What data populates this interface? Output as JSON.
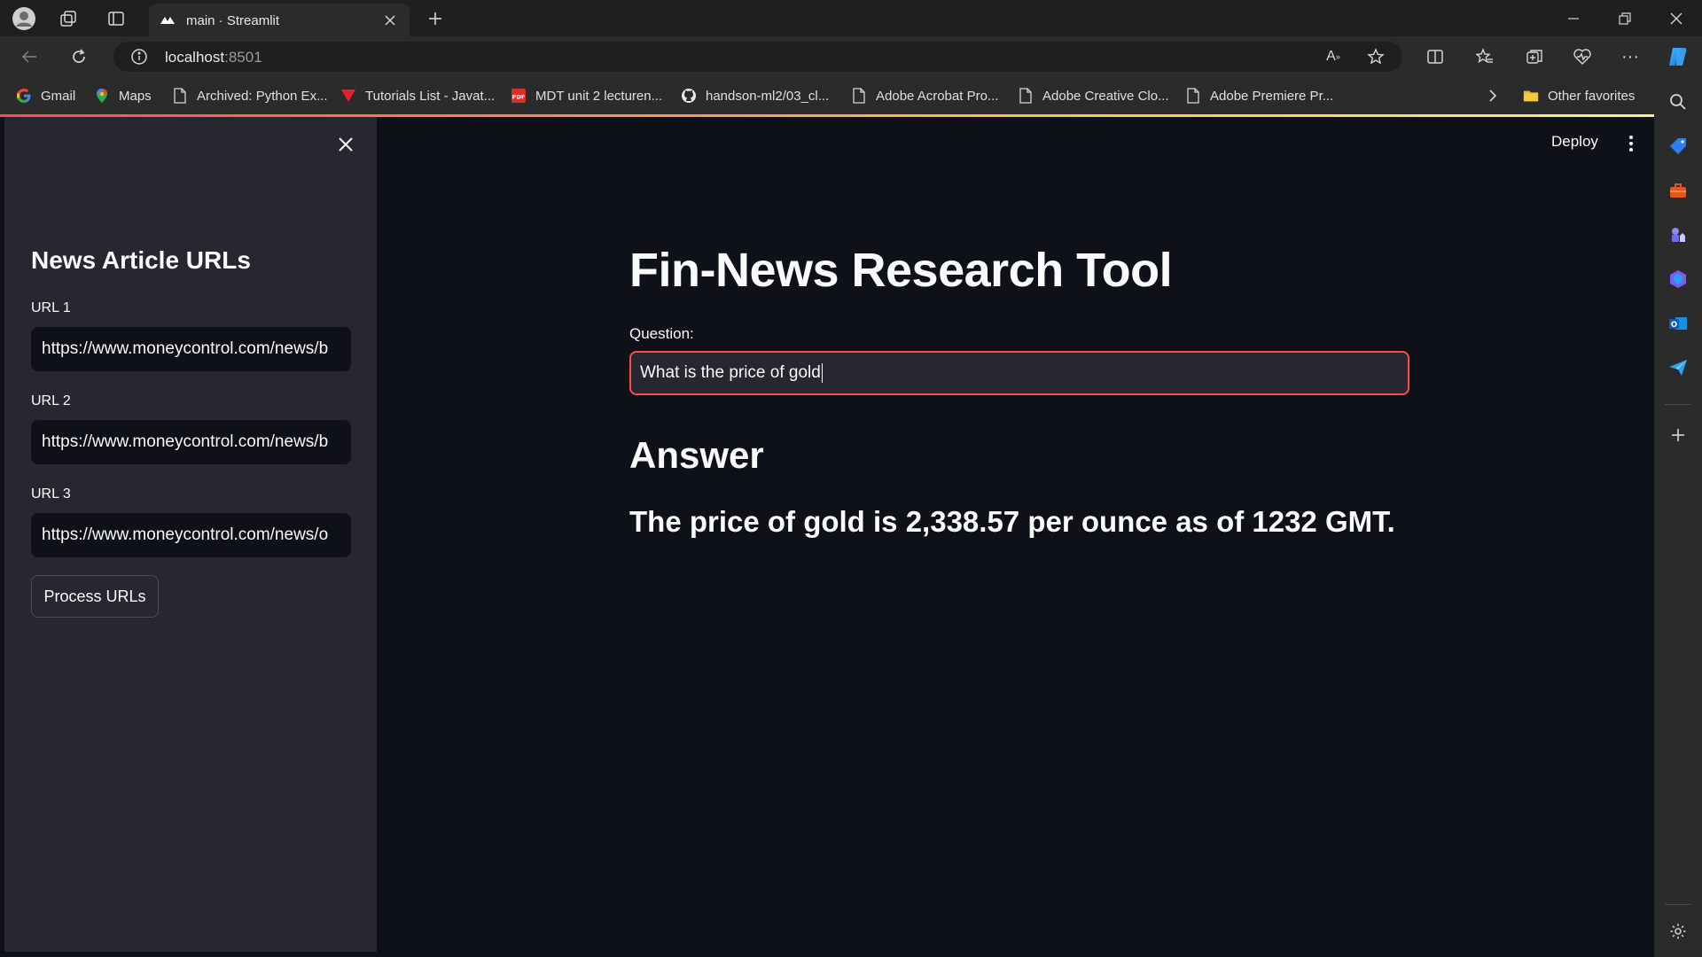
{
  "browser": {
    "tab_title": "main · Streamlit",
    "address": {
      "host": "localhost",
      "port": ":8501"
    },
    "bookmarks": [
      {
        "label": "Gmail",
        "icon": "google-icon"
      },
      {
        "label": "Maps",
        "icon": "maps-pin-icon"
      },
      {
        "label": "Archived: Python Ex...",
        "icon": "page-icon"
      },
      {
        "label": "Tutorials List - Javat...",
        "icon": "javatpoint-icon"
      },
      {
        "label": "MDT unit 2 lecturen...",
        "icon": "pdf-icon"
      },
      {
        "label": "handson-ml2/03_cl...",
        "icon": "github-icon"
      },
      {
        "label": "Adobe Acrobat Pro...",
        "icon": "page-icon"
      },
      {
        "label": "Adobe Creative Clo...",
        "icon": "page-icon"
      },
      {
        "label": "Adobe Premiere Pr...",
        "icon": "page-icon"
      }
    ],
    "other_favorites": "Other favorites"
  },
  "sidebar": {
    "heading": "News Article URLs",
    "urls": [
      {
        "label": "URL 1",
        "value": "https://www.moneycontrol.com/news/b"
      },
      {
        "label": "URL 2",
        "value": "https://www.moneycontrol.com/news/b"
      },
      {
        "label": "URL 3",
        "value": "https://www.moneycontrol.com/news/o"
      }
    ],
    "process_button": "Process URLs"
  },
  "header": {
    "deploy": "Deploy"
  },
  "main": {
    "title": "Fin-News Research Tool",
    "question_label": "Question:",
    "question_value": "What is the price of gold",
    "answer_heading": "Answer",
    "answer_text": "The price of gold is 2,338.57 per ounce as of 1232 GMT."
  },
  "colors": {
    "accent": "#ff4b4b",
    "sidebar_bg": "#262730",
    "main_bg": "#0e1117"
  }
}
